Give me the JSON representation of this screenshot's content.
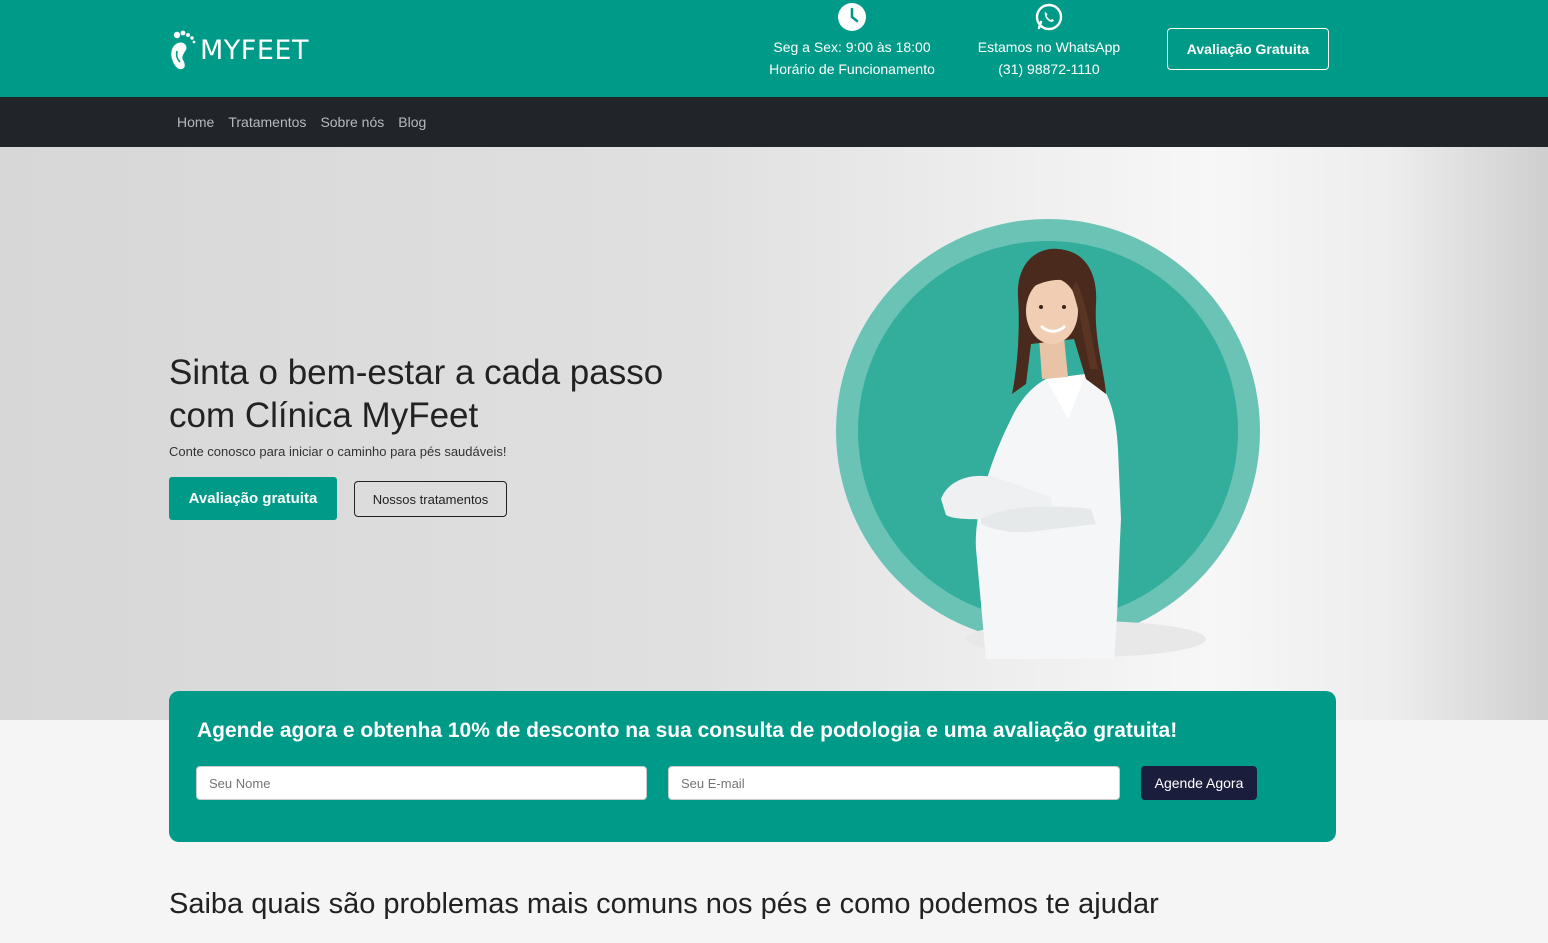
{
  "brand": {
    "name": "MYFEET",
    "logo_icon": "footprint-icon",
    "accent": "#009b88",
    "dark": "#212529"
  },
  "header": {
    "hours": {
      "icon": "clock-icon",
      "line1": "Seg a Sex: 9:00 às 18:00",
      "line2": "Horário de Funcionamento"
    },
    "whatsapp": {
      "icon": "whatsapp-icon",
      "line1": "Estamos no WhatsApp",
      "line2": "(31) 98872-1110"
    },
    "cta_label": "Avaliação Gratuita"
  },
  "nav": {
    "items": [
      "Home",
      "Tratamentos",
      "Sobre nós",
      "Blog"
    ]
  },
  "hero": {
    "title": "Sinta o bem-estar a cada passo com Clínica MyFeet",
    "subtitle": "Conte conosco para iniciar o caminho para pés saudáveis!",
    "primary_button": "Avaliação gratuita",
    "secondary_button": "Nossos tratamentos"
  },
  "promo": {
    "title": "Agende agora e obtenha 10% de desconto na sua consulta de podologia e uma avaliação gratuita!",
    "name_placeholder": "Seu Nome",
    "email_placeholder": "Seu E-mail",
    "submit_label": "Agende Agora"
  },
  "problems": {
    "title": "Saiba quais são problemas mais comuns nos pés e como podemos te ajudar"
  }
}
